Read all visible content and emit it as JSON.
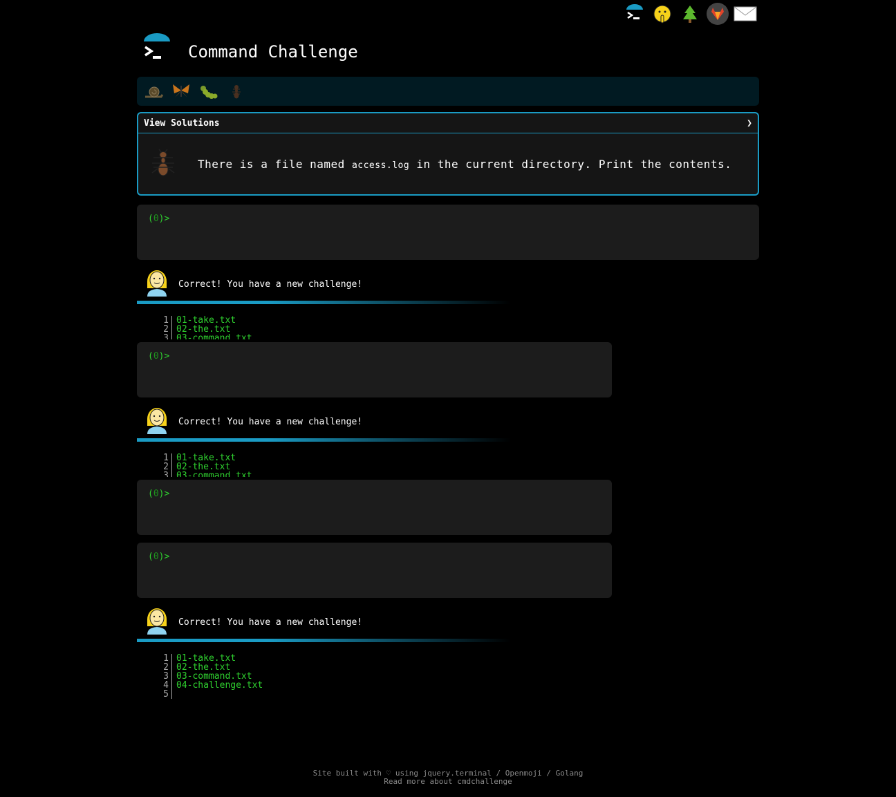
{
  "site": {
    "title": "Command Challenge"
  },
  "top_icons": [
    "cmdchallenge-logo-icon",
    "shushing-face-icon",
    "tree-icon",
    "gitlab-icon",
    "envelope-icon"
  ],
  "levels": [
    "snail-icon",
    "butterfly-icon",
    "caterpillar-icon",
    "ant-icon"
  ],
  "challenge": {
    "view_solutions": "View Solutions",
    "chevron": "❯",
    "text_before": "There is a file named",
    "code": "access.log",
    "text_after": "in the current directory. Print the contents."
  },
  "terminal": {
    "prompt_open": "(",
    "exit_code": "0",
    "prompt_close": ")>"
  },
  "feedback": {
    "message": "Correct! You have a new challenge!"
  },
  "listing": {
    "numbers": [
      "1",
      "2",
      "3",
      "4",
      "5"
    ],
    "files": [
      "01-take.txt",
      "02-the.txt",
      "03-command.txt",
      "04-challenge.txt",
      ""
    ]
  },
  "footer": {
    "line1": "Site built with ♡ using jquery.terminal / Openmoji / Golang",
    "line2": "Read more about cmdchallenge"
  },
  "colors": {
    "accent": "#1a9bc4",
    "prompt": "#2fd12f",
    "level_bar": "#011a22",
    "terminal_bg": "#1c1c1c"
  }
}
